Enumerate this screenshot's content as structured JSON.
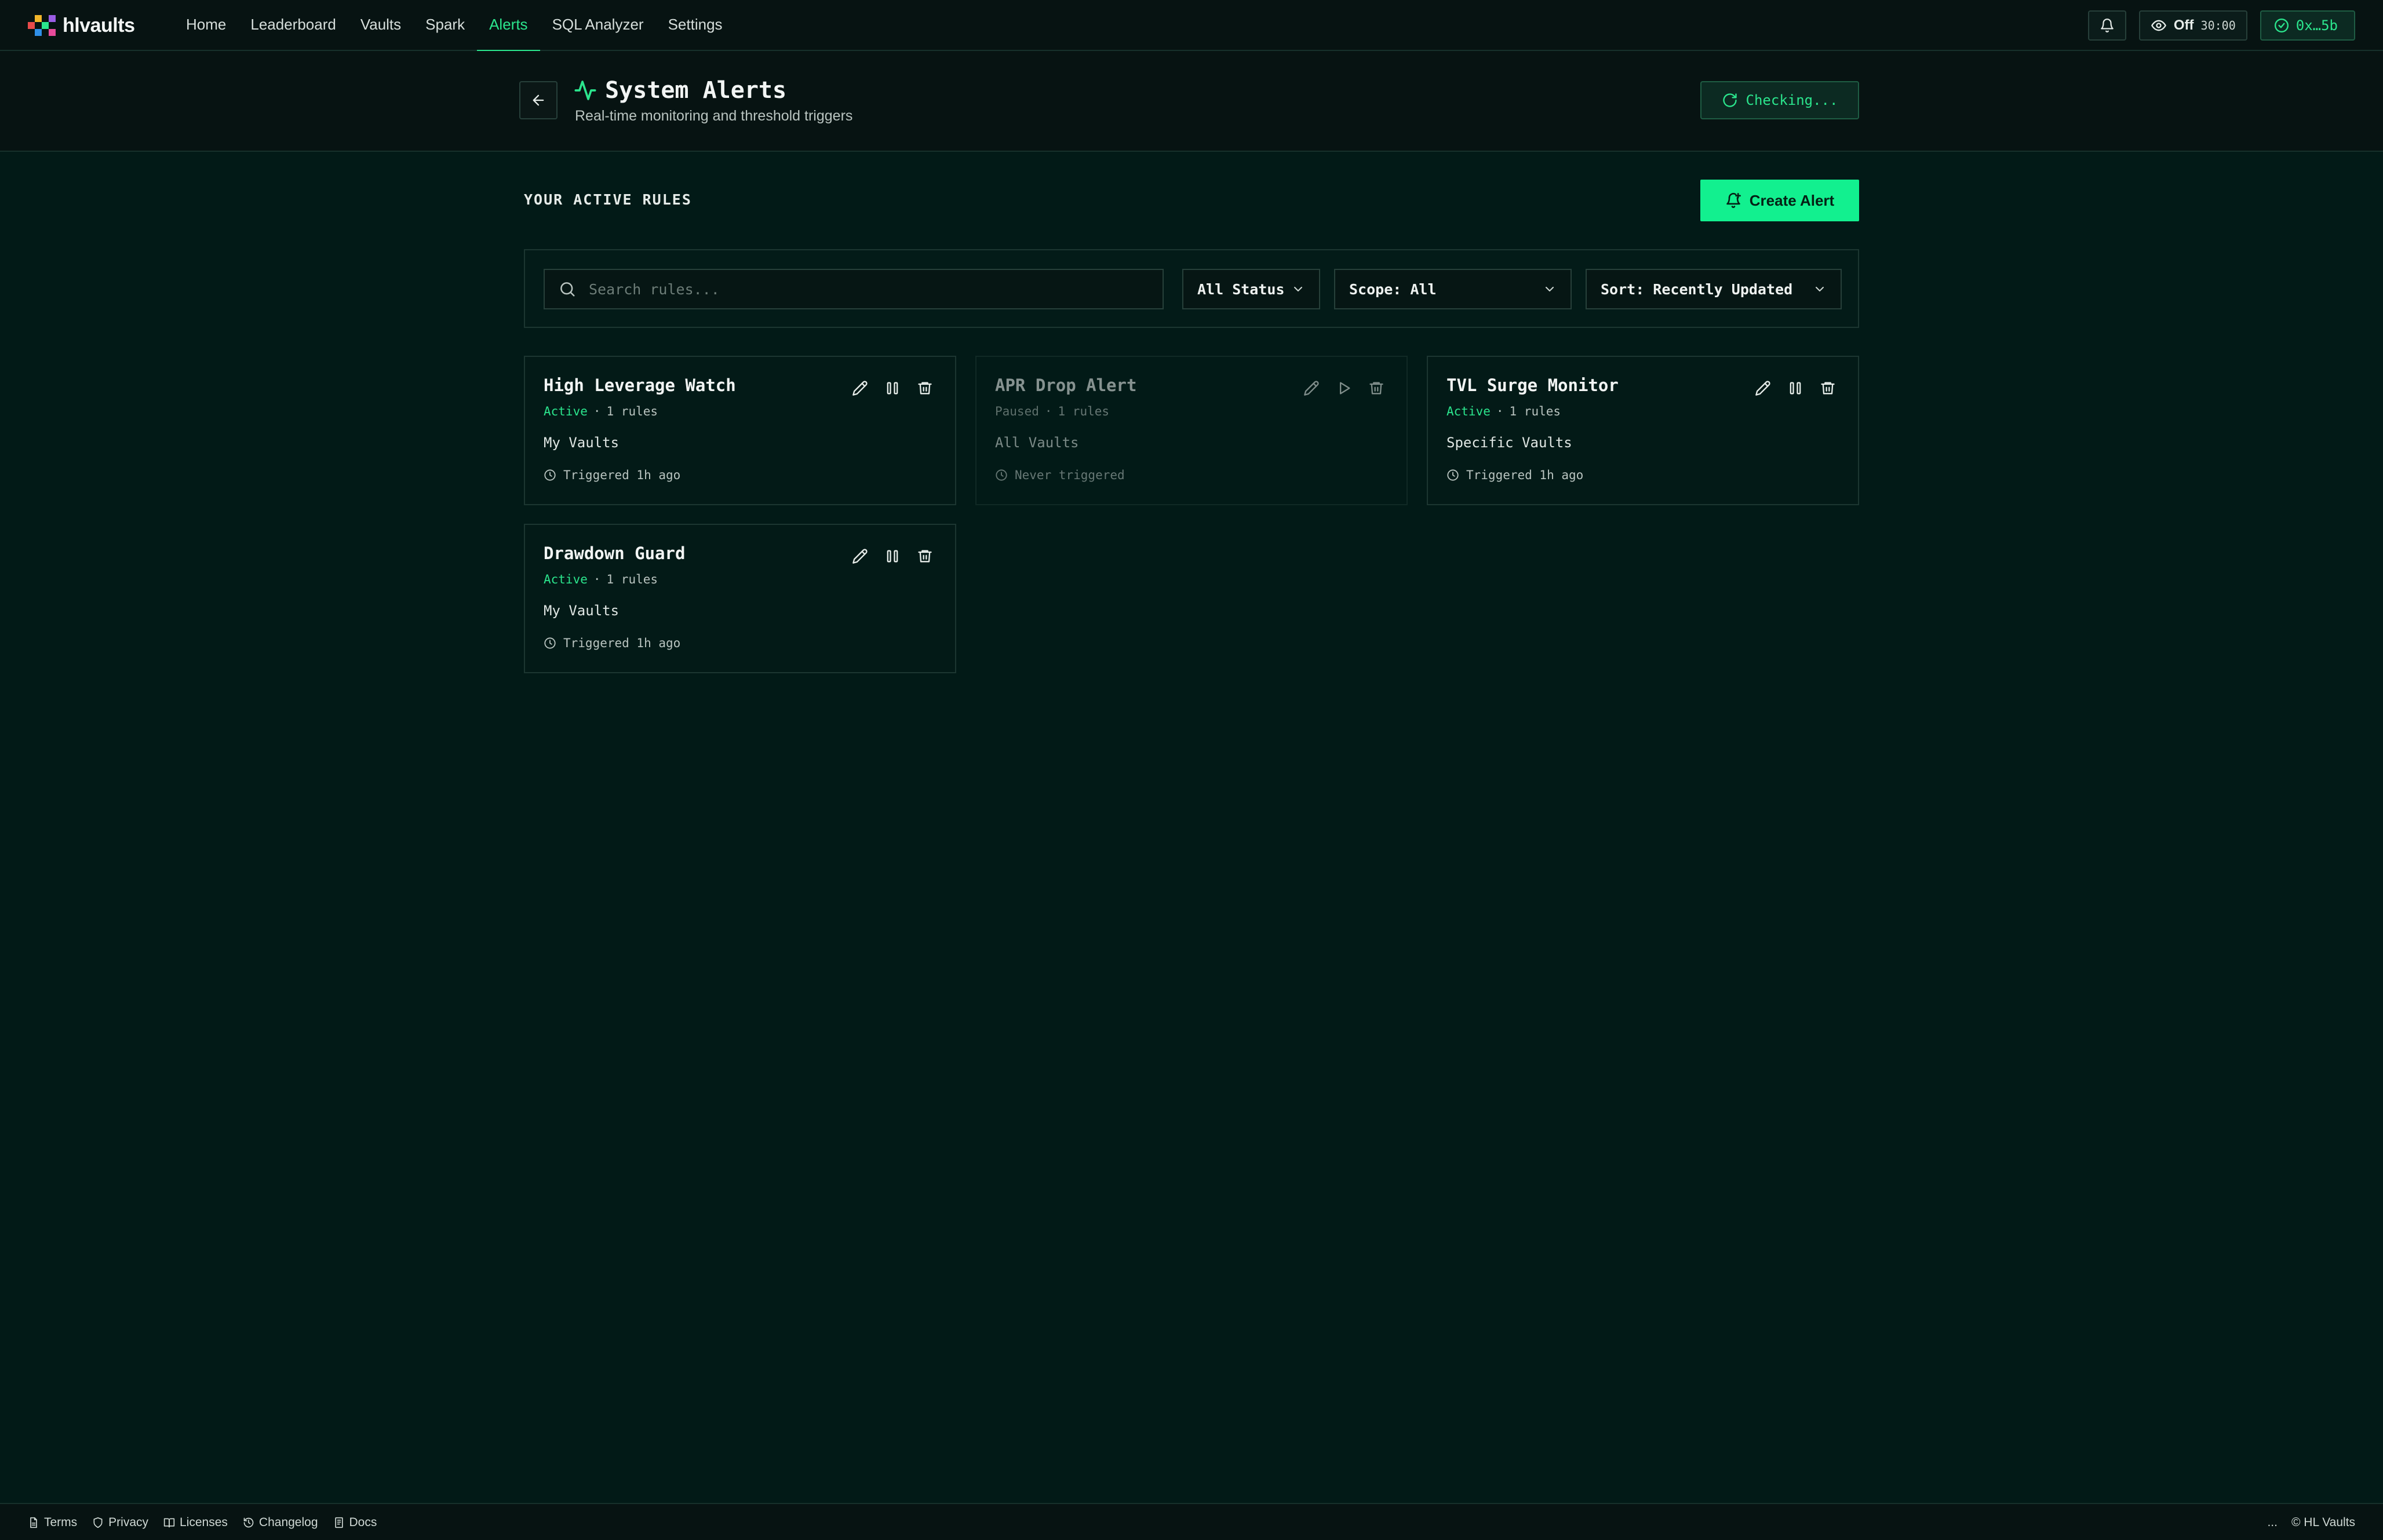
{
  "nav": {
    "brand": "hlvaults",
    "links": [
      {
        "label": "Home"
      },
      {
        "label": "Leaderboard"
      },
      {
        "label": "Vaults"
      },
      {
        "label": "Spark"
      },
      {
        "label": "Alerts",
        "active": true
      },
      {
        "label": "SQL Analyzer"
      },
      {
        "label": "Settings"
      }
    ],
    "watch_label": "Off",
    "watch_timer": "30:00",
    "wallet": "0x…5b"
  },
  "header": {
    "title": "System Alerts",
    "subtitle": "Real-time monitoring and threshold triggers",
    "checking_label": "Checking..."
  },
  "main": {
    "section_title": "YOUR ACTIVE RULES",
    "create_label": "Create Alert",
    "search_placeholder": "Search rules...",
    "filters": {
      "status": "All Status",
      "scope": "Scope: All",
      "sort": "Sort: Recently Updated"
    }
  },
  "rules": [
    {
      "name": "High Leverage Watch",
      "status": "Active",
      "rules": "1 rules",
      "scope": "My Vaults",
      "trigger": "Triggered 1h ago"
    },
    {
      "name": "APR Drop Alert",
      "status": "Paused",
      "rules": "1 rules",
      "scope": "All Vaults",
      "trigger": "Never triggered"
    },
    {
      "name": "TVL Surge Monitor",
      "status": "Active",
      "rules": "1 rules",
      "scope": "Specific Vaults",
      "trigger": "Triggered 1h ago"
    },
    {
      "name": "Drawdown Guard",
      "status": "Active",
      "rules": "1 rules",
      "scope": "My Vaults",
      "trigger": "Triggered 1h ago"
    }
  ],
  "footer": {
    "links": [
      "Terms",
      "Privacy",
      "Licenses",
      "Changelog",
      "Docs"
    ],
    "dots": "...",
    "copyright": "© HL Vaults"
  },
  "colors": {
    "accent": "#2be58d",
    "button": "#12f08f",
    "background": "#021a17"
  }
}
